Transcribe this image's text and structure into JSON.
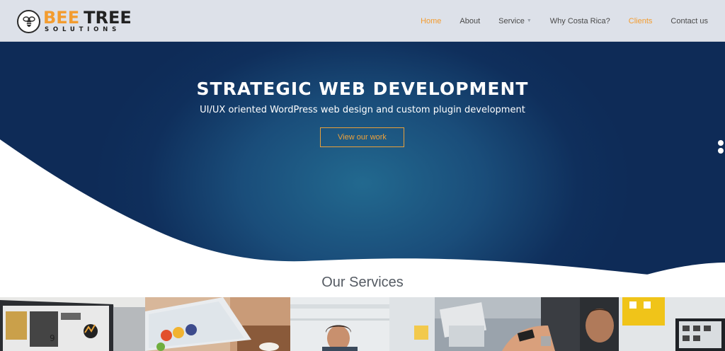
{
  "brand": {
    "word1": "BEE",
    "word2": "TREE",
    "tagline": "SOLUTIONS",
    "icon": "bee-icon",
    "accent_color": "#f39c2f"
  },
  "nav": {
    "items": [
      {
        "label": "Home",
        "state": "active"
      },
      {
        "label": "About"
      },
      {
        "label": "Service",
        "has_dropdown": true
      },
      {
        "label": "Why Costa Rica?"
      },
      {
        "label": "Clients",
        "state": "highlight"
      },
      {
        "label": "Contact us"
      }
    ]
  },
  "hero": {
    "title": "STRATEGIC WEB DEVELOPMENT",
    "subtitle": "UI/UX oriented WordPress web design and custom plugin development",
    "button_label": "View our work",
    "slider_dots": 2
  },
  "services": {
    "title": "Our Services",
    "thumbnails": [
      {
        "icon": "laptop-photo-icon"
      },
      {
        "icon": "tablet-photo-icon"
      },
      {
        "icon": "person-office-photo-icon"
      },
      {
        "icon": "phone-hands-photo-icon"
      },
      {
        "icon": "desk-monitor-photo-icon"
      }
    ]
  }
}
